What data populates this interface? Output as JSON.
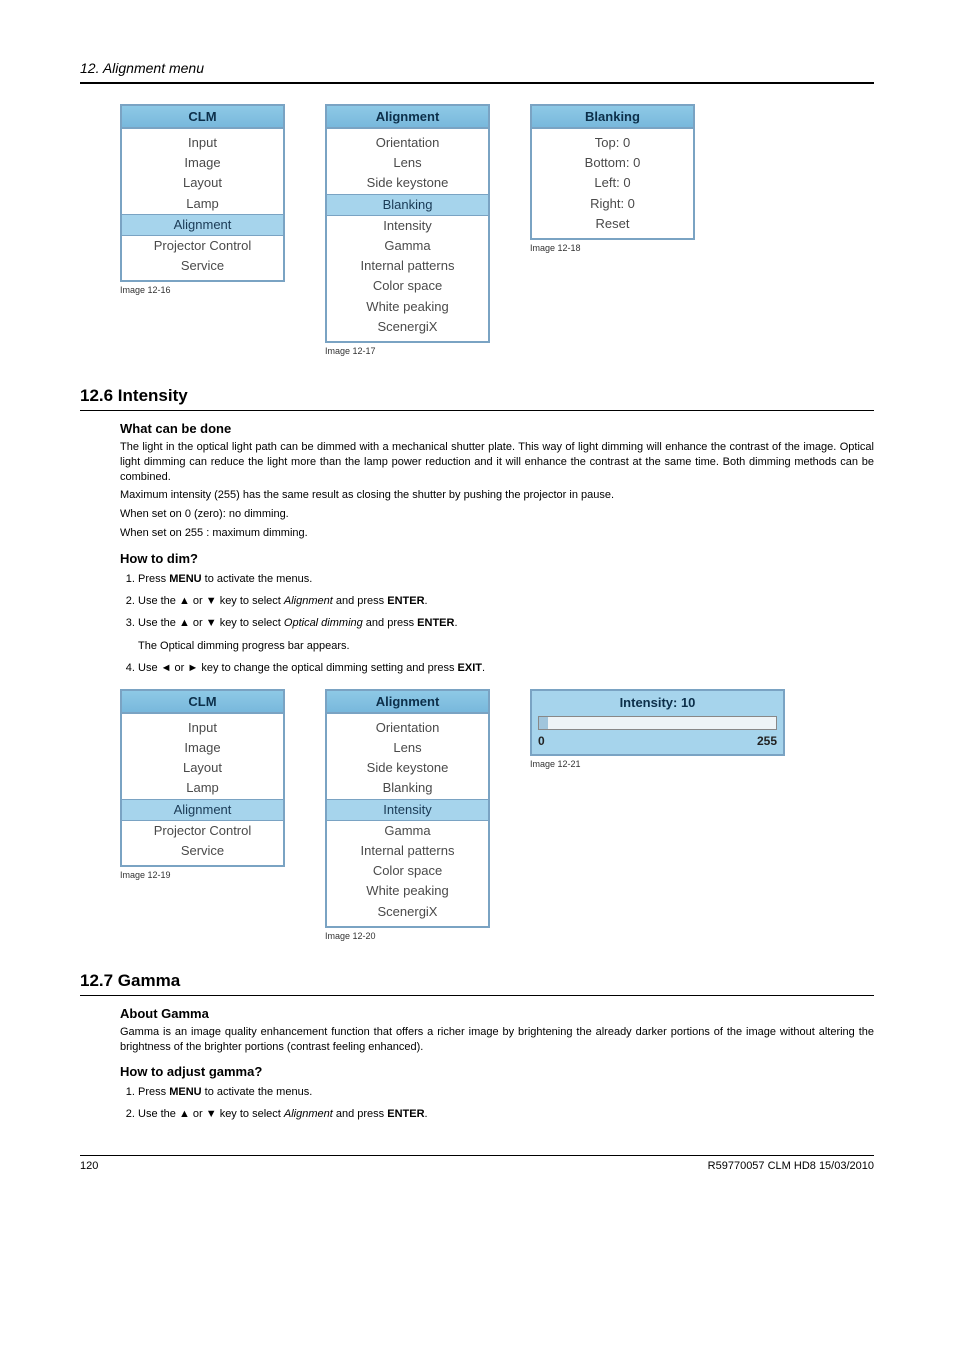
{
  "header": {
    "chapter": "12.  Alignment menu"
  },
  "row1": {
    "clm": {
      "title": "CLM",
      "items": [
        "Input",
        "Image",
        "Layout",
        "Lamp",
        "Alignment",
        "Projector Control",
        "Service"
      ],
      "selected": 4,
      "caption": "Image 12-16"
    },
    "alignment": {
      "title": "Alignment",
      "items": [
        "Orientation",
        "Lens",
        "Side keystone",
        "Blanking",
        "Intensity",
        "Gamma",
        "Internal patterns",
        "Color space",
        "White peaking",
        "ScenergiX"
      ],
      "selected": 3,
      "caption": "Image 12-17"
    },
    "blanking": {
      "title": "Blanking",
      "items": [
        "Top: 0",
        "Bottom: 0",
        "Left: 0",
        "Right: 0",
        "Reset"
      ],
      "selected": -1,
      "caption": "Image 12-18"
    }
  },
  "section126": {
    "heading": "12.6  Intensity",
    "sub1": "What can be done",
    "p1": "The light in the optical light path can be dimmed with a mechanical shutter plate. This way of light dimming will enhance the contrast of the image. Optical light dimming can reduce the light more than the lamp power reduction and it will enhance the contrast at the same time.  Both dimming methods can be combined.",
    "p2": "Maximum intensity (255) has the same result as closing the shutter by pushing the projector in pause.",
    "p3": "When set on 0 (zero):  no dimming.",
    "p4": "When set on 255 :  maximum dimming.",
    "sub2": "How to dim?",
    "steps": {
      "s1a": "Press ",
      "s1b": "MENU",
      "s1c": " to activate the menus.",
      "s2a": "Use the ▲ or ▼ key to select ",
      "s2b": "Alignment",
      "s2c": " and press ",
      "s2d": "ENTER",
      "s2e": ".",
      "s3a": "Use the ▲ or ▼ key to select ",
      "s3b": "Optical dimming",
      "s3c": " and press ",
      "s3d": "ENTER",
      "s3e": ".",
      "s3sub": "The Optical dimming progress bar appears.",
      "s4a": "Use ◄ or ► key to change the optical dimming setting and press ",
      "s4b": "EXIT",
      "s4c": "."
    }
  },
  "row2": {
    "clm": {
      "title": "CLM",
      "items": [
        "Input",
        "Image",
        "Layout",
        "Lamp",
        "Alignment",
        "Projector Control",
        "Service"
      ],
      "selected": 4,
      "caption": "Image 12-19"
    },
    "alignment": {
      "title": "Alignment",
      "items": [
        "Orientation",
        "Lens",
        "Side keystone",
        "Blanking",
        "Intensity",
        "Gamma",
        "Internal patterns",
        "Color space",
        "White peaking",
        "ScenergiX"
      ],
      "selected": 4,
      "caption": "Image 12-20"
    },
    "slider": {
      "title": "Intensity: 10",
      "min": "0",
      "max": "255",
      "caption": "Image 12-21"
    }
  },
  "section127": {
    "heading": "12.7  Gamma",
    "sub1": "About Gamma",
    "p1": "Gamma is an image quality enhancement function that offers a richer image by brightening the already darker portions of the image without altering the brightness of the brighter portions (contrast feeling enhanced).",
    "sub2": "How to adjust gamma?",
    "steps": {
      "s1a": "Press ",
      "s1b": "MENU",
      "s1c": " to activate the menus.",
      "s2a": "Use the ▲ or ▼ key to select ",
      "s2b": "Alignment",
      "s2c": " and press ",
      "s2d": "ENTER",
      "s2e": "."
    }
  },
  "footer": {
    "page": "120",
    "doc": "R59770057  CLM HD8  15/03/2010"
  },
  "chart_data": {
    "type": "bar",
    "title": "Intensity: 10",
    "min": 0,
    "max": 255,
    "value": 10,
    "note": "Horizontal progress/slider bar; fill indicates current intensity value."
  }
}
